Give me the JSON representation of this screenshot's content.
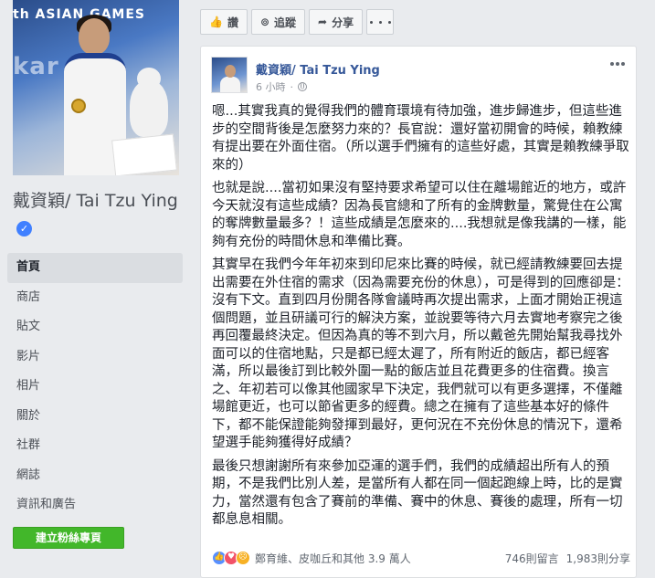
{
  "page": {
    "name": "戴資穎/ Tai Tzu Ying",
    "cover_banner_line1": "th ASIAN GAMES",
    "cover_banner_line2": "kar a"
  },
  "nav": {
    "items": [
      {
        "label": "首頁"
      },
      {
        "label": "商店"
      },
      {
        "label": "貼文"
      },
      {
        "label": "影片"
      },
      {
        "label": "相片"
      },
      {
        "label": "關於"
      },
      {
        "label": "社群"
      },
      {
        "label": "網誌"
      },
      {
        "label": "資訊和廣告"
      }
    ],
    "create_page_label": "建立粉絲專頁"
  },
  "action_bar": {
    "like_label": "讚",
    "follow_label": "追蹤",
    "share_label": "分享",
    "like_icon": "thumbs-up-icon",
    "follow_icon": "rss-icon",
    "share_icon": "share-arrow-icon"
  },
  "post": {
    "author": "戴資穎/ Tai Tzu Ying",
    "time": "6 小時",
    "separator": "·",
    "paragraphs": [
      "嗯...其實我真的覺得我們的體育環境有待加強，進步歸進步，但這些進步的空間背後是怎麼努力來的？長官說：還好當初開會的時候，賴教練有提出要在外面住宿。（所以選手們擁有的這些好處，其實是賴教練爭取來的）",
      "也就是說....當初如果沒有堅持要求希望可以住在離場館近的地方，或許今天就沒有這些成績？因為長官總和了所有的金牌數量，驚覺住在公寓的奪牌數量最多？！這些成績是怎麼來的....我想就是像我講的一樣，能夠有充份的時間休息和準備比賽。",
      "其實早在我們今年年初來到印尼來比賽的時候，就已經請教練要回去提出需要在外住宿的需求（因為需要充份的休息），可是得到的回應卻是：沒有下文。直到四月份開各隊會議時再次提出需求，上面才開始正視這個問題，並且研議可行的解決方案，並說要等待六月去實地考察完之後再回覆最終決定。但因為真的等不到六月，所以戴爸先開始幫我尋找外面可以的住宿地點，只是都已經太遲了，所有附近的飯店，都已經客滿，所以最後訂到比較外圍一點的飯店並且花費更多的住宿費。換言之、年初若可以像其他國家早下決定，我們就可以有更多選擇，不僅離場館更近，也可以節省更多的經費。總之在擁有了這些基本好的條件下，都不能保證能夠發揮到最好，更何況在不充份休息的情況下，還希望選手能夠獲得好成績？",
      "最後只想謝謝所有來參加亞運的選手們，我們的成績超出所有人的預期，不是我們比別人差，是當所有人都在同一個起跑線上時，比的是實力，當然還有包含了賽前的準備、賽中的休息、賽後的處理，所有一切都息息相關。"
    ],
    "reactions_text": "鄭育維、皮咖丘和其他 3.9 萬人",
    "comments": "746則留言",
    "shares": "1,983則分享",
    "reaction_icons": [
      "like-reaction-icon",
      "love-reaction-icon",
      "sad-reaction-icon"
    ]
  },
  "colors": {
    "link": "#365899",
    "accent": "#4080ff",
    "create_button": "#42b72a"
  }
}
